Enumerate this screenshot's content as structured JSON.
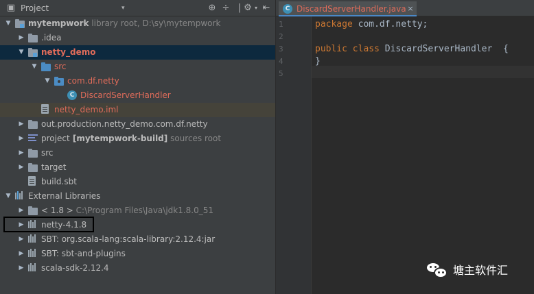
{
  "toolwindow": {
    "title": "Project",
    "dropdown_glyph": "▾",
    "icons": [
      "sync-icon",
      "collapse-all-icon",
      "settings-icon",
      "hide-icon"
    ]
  },
  "tree": [
    {
      "label": "mytempwork",
      "suffix": "library root,  D:\\sy\\mytempwork",
      "depth": 0,
      "expanded": true,
      "icon": "module-folder-icon",
      "bold": true
    },
    {
      "label": ".idea",
      "depth": 1,
      "expanded": false,
      "icon": "folder-icon"
    },
    {
      "label": "netty_demo",
      "depth": 1,
      "expanded": true,
      "icon": "module-folder-icon",
      "bold": true,
      "color": "#e06c5a",
      "state": "selected"
    },
    {
      "label": "src",
      "depth": 2,
      "expanded": true,
      "icon": "source-folder-icon",
      "color": "#e06c5a"
    },
    {
      "label": "com.df.netty",
      "depth": 3,
      "expanded": true,
      "icon": "package-icon",
      "color": "#e06c5a"
    },
    {
      "label": "DiscardServerHandler",
      "depth": 4,
      "icon": "class-icon",
      "color": "#e06c5a"
    },
    {
      "label": "netty_demo.iml",
      "depth": 2,
      "icon": "iml-file-icon",
      "color": "#e06c5a",
      "state": "module"
    },
    {
      "label": "out.production.netty_demo.com.df.netty",
      "depth": 1,
      "expanded": false,
      "icon": "folder-icon"
    },
    {
      "label": "project",
      "suffix_bold": "[mytempwork-build]",
      "suffix": "sources root",
      "depth": 1,
      "expanded": false,
      "icon": "project-icon"
    },
    {
      "label": "src",
      "depth": 1,
      "expanded": false,
      "icon": "folder-icon"
    },
    {
      "label": "target",
      "depth": 1,
      "expanded": false,
      "icon": "folder-icon"
    },
    {
      "label": "build.sbt",
      "depth": 1,
      "icon": "sbt-file-icon"
    },
    {
      "label": "External Libraries",
      "depth": 0,
      "expanded": true,
      "icon": "libraries-icon"
    },
    {
      "label": "< 1.8 >",
      "suffix": "C:\\Program Files\\Java\\jdk1.8.0_51",
      "depth": 1,
      "expanded": false,
      "icon": "jdk-folder-icon"
    },
    {
      "label": "netty-4.1.8",
      "depth": 1,
      "expanded": false,
      "icon": "library-icon"
    },
    {
      "label": "SBT: org.scala-lang:scala-library:2.12.4:jar",
      "depth": 1,
      "expanded": false,
      "icon": "library-icon"
    },
    {
      "label": "SBT: sbt-and-plugins",
      "depth": 1,
      "expanded": false,
      "icon": "library-icon"
    },
    {
      "label": "scala-sdk-2.12.4",
      "depth": 1,
      "expanded": false,
      "icon": "library-icon"
    }
  ],
  "editor": {
    "tab": {
      "label": "DiscardServerHandler.java",
      "close_glyph": "×",
      "icon_letter": "C"
    },
    "line_numbers": [
      "1",
      "2",
      "3",
      "4",
      "5"
    ],
    "code_lines": [
      [
        {
          "t": "package",
          "k": true
        },
        {
          "t": " com.df.netty;"
        }
      ],
      [],
      [
        {
          "t": "public",
          "k": true
        },
        {
          "t": " "
        },
        {
          "t": "class",
          "k": true
        },
        {
          "t": " DiscardServerHandler  {"
        }
      ],
      [
        {
          "t": "}"
        }
      ],
      []
    ]
  },
  "watermark": {
    "text": "塘主软件汇"
  },
  "colors": {
    "accent": "#4a88c7",
    "keyword": "#cc7832",
    "modified_file": "#e06c5a",
    "selection": "#0d293e"
  }
}
